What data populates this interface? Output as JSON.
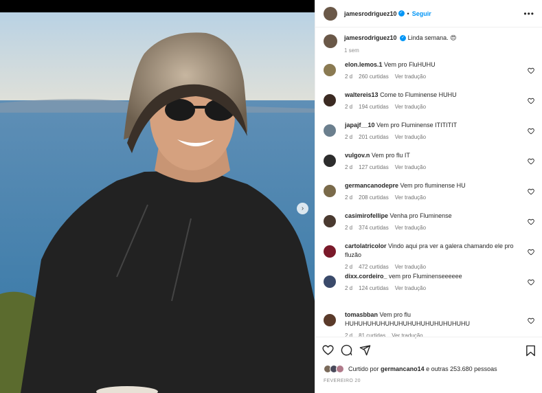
{
  "post": {
    "author": "jamesrodriguez10",
    "follow_label": "Seguir",
    "dot": "•",
    "more": "•••",
    "caption": "Linda semana. 😍",
    "caption_time": "1 sem"
  },
  "comments": [
    {
      "user": "elon.lemos.1",
      "text": "Vem pro FluHUHU",
      "age": "2 d",
      "likes": "260 curtidas",
      "translate": "Ver tradução",
      "avatar_color": "#8a7a52"
    },
    {
      "user": "waltereis13",
      "text": "Come to Fluminense HUHU",
      "age": "2 d",
      "likes": "194 curtidas",
      "translate": "Ver tradução",
      "avatar_color": "#3b2a22"
    },
    {
      "user": "japajf__10",
      "text": "Vem pro Fluminense ITITITIT",
      "age": "2 d",
      "likes": "201 curtidas",
      "translate": "Ver tradução",
      "avatar_color": "#6b7f8e"
    },
    {
      "user": "vulgov.n",
      "text": "Vem pro flu IT",
      "age": "2 d",
      "likes": "127 curtidas",
      "translate": "Ver tradução",
      "avatar_color": "#2d2d2d"
    },
    {
      "user": "germancanodepre",
      "text": "Vem pro fluminense HU",
      "age": "2 d",
      "likes": "208 curtidas",
      "translate": "Ver tradução",
      "avatar_color": "#7a6a4a"
    },
    {
      "user": "casimirofellipe",
      "text": "Venha pro Fluminense",
      "age": "2 d",
      "likes": "374 curtidas",
      "translate": "Ver tradução",
      "avatar_color": "#4a3a30"
    },
    {
      "user": "cartolatricolor",
      "text": "Vindo aqui pra ver a galera chamando ele pro fluzão",
      "age": "2 d",
      "likes": "472 curtidas",
      "translate": "Ver tradução",
      "avatar_color": "#7a1a2a"
    },
    {
      "user": "dixx.cordeiro_",
      "text": "vem pro Fluminenseeeeee",
      "age": "2 d",
      "likes": "124 curtidas",
      "translate": "Ver tradução",
      "avatar_color": "#3a4a6a"
    },
    {
      "user": "tomasbban",
      "text": "Vem pro flu HUHUHUHUHUHUHUHUHUHUHUHUHUHU",
      "age": "2 d",
      "likes": "81 curtidas",
      "translate": "Ver tradução",
      "avatar_color": "#5a3a2a"
    }
  ],
  "likes": {
    "prefix": "Curtido por",
    "user": "germancano14",
    "suffix": "e outras 253.680 pessoas"
  },
  "date": "FEVEREIRO 20",
  "colors": {
    "accent": "#0095f6",
    "muted": "#8e8e8e",
    "text": "#262626"
  },
  "icons": [
    "verified-icon",
    "more-icon",
    "heart-icon",
    "comment-icon",
    "share-icon",
    "bookmark-icon",
    "chevron-right-icon"
  ]
}
